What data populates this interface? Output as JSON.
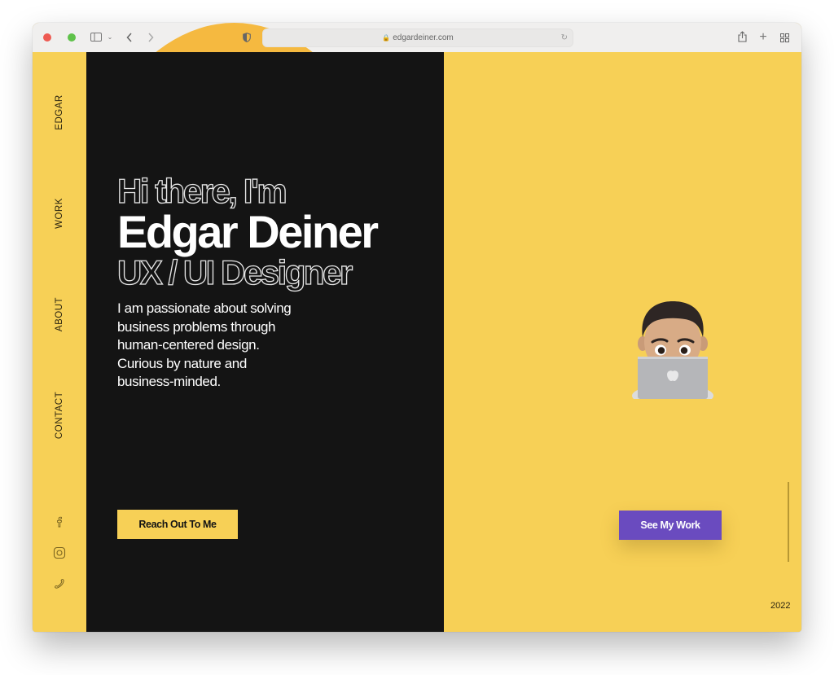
{
  "browser": {
    "url": "edgardeiner.com",
    "icons": [
      "sidebar-toggle-icon",
      "chevron-down-icon",
      "back-icon",
      "forward-icon",
      "privacy-shield-icon",
      "lock-icon",
      "reload-icon",
      "share-icon",
      "new-tab-icon",
      "tab-overview-icon"
    ]
  },
  "sidebar": {
    "items": [
      {
        "label": "EDGAR"
      },
      {
        "label": "WORK"
      },
      {
        "label": "ABOUT"
      },
      {
        "label": "CONTACT"
      }
    ],
    "social": [
      "facebook-icon",
      "instagram-icon",
      "phone-icon"
    ]
  },
  "hero": {
    "greeting": "Hi there, I'm",
    "name": "Edgar Deiner",
    "role": "UX / UI Designer",
    "bio_lines": [
      "I am passionate about solving",
      "business problems through",
      "human-centered design.",
      "Curious by nature and",
      "business-minded."
    ],
    "cta_primary": "Reach Out To Me",
    "cta_secondary": "See My Work"
  },
  "footer": {
    "year": "2022"
  },
  "colors": {
    "accent_yellow": "#f7d056",
    "dark_panel": "#141414",
    "button_purple": "#6a4bbf"
  }
}
